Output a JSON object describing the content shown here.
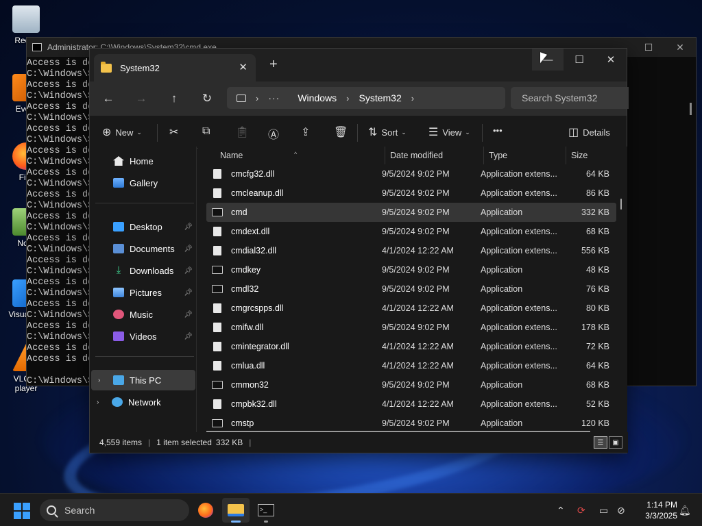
{
  "desktop": {
    "icons": [
      {
        "label": "Recyc"
      },
      {
        "label": "Every"
      },
      {
        "label": "Fire"
      },
      {
        "label": "Note"
      },
      {
        "label": "Visual Co"
      },
      {
        "label": "VLC m player"
      }
    ]
  },
  "cmd": {
    "title": "Administrator: C:\\Windows\\System32\\cmd.exe",
    "lines": [
      "Access is de",
      "C:\\Windows\\S",
      "Access is de",
      "C:\\Windows\\S",
      "Access is de",
      "C:\\Windows\\S",
      "Access is de",
      "C:\\Windows\\S",
      "Access is de",
      "C:\\Windows\\S",
      "Access is de",
      "C:\\Windows\\S",
      "Access is de",
      "C:\\Windows\\S",
      "Access is de",
      "C:\\Windows\\S",
      "Access is de",
      "C:\\Windows\\S",
      "Access is de",
      "C:\\Windows\\S",
      "Access is de",
      "C:\\Windows\\S",
      "Access is de",
      "C:\\Windows\\S",
      "Access is de",
      "C:\\Windows\\S",
      "Access is de",
      "Access is de",
      "",
      "C:\\Windows\\S"
    ]
  },
  "explorer": {
    "tab_title": "System32",
    "address": {
      "root": "Windows",
      "current": "System32"
    },
    "search_placeholder": "Search System32",
    "toolbar": {
      "new_label": "New",
      "sort_label": "Sort",
      "view_label": "View",
      "more_label": "•••",
      "details_label": "Details"
    },
    "nav": {
      "home": "Home",
      "gallery": "Gallery",
      "desktop": "Desktop",
      "documents": "Documents",
      "downloads": "Downloads",
      "pictures": "Pictures",
      "music": "Music",
      "videos": "Videos",
      "this_pc": "This PC",
      "network": "Network"
    },
    "columns": {
      "name": "Name",
      "date": "Date modified",
      "type": "Type",
      "size": "Size"
    },
    "files": [
      {
        "name": "cmcfg32.dll",
        "date": "9/5/2024 9:02 PM",
        "type": "Application extens...",
        "size": "64 KB",
        "kind": "dll"
      },
      {
        "name": "cmcleanup.dll",
        "date": "9/5/2024 9:02 PM",
        "type": "Application extens...",
        "size": "86 KB",
        "kind": "dll"
      },
      {
        "name": "cmd",
        "date": "9/5/2024 9:02 PM",
        "type": "Application",
        "size": "332 KB",
        "kind": "app"
      },
      {
        "name": "cmdext.dll",
        "date": "9/5/2024 9:02 PM",
        "type": "Application extens...",
        "size": "68 KB",
        "kind": "dll"
      },
      {
        "name": "cmdial32.dll",
        "date": "4/1/2024 12:22 AM",
        "type": "Application extens...",
        "size": "556 KB",
        "kind": "dll"
      },
      {
        "name": "cmdkey",
        "date": "9/5/2024 9:02 PM",
        "type": "Application",
        "size": "48 KB",
        "kind": "app"
      },
      {
        "name": "cmdl32",
        "date": "9/5/2024 9:02 PM",
        "type": "Application",
        "size": "76 KB",
        "kind": "app"
      },
      {
        "name": "cmgrcspps.dll",
        "date": "4/1/2024 12:22 AM",
        "type": "Application extens...",
        "size": "80 KB",
        "kind": "dll"
      },
      {
        "name": "cmifw.dll",
        "date": "9/5/2024 9:02 PM",
        "type": "Application extens...",
        "size": "178 KB",
        "kind": "dll"
      },
      {
        "name": "cmintegrator.dll",
        "date": "4/1/2024 12:22 AM",
        "type": "Application extens...",
        "size": "72 KB",
        "kind": "dll"
      },
      {
        "name": "cmlua.dll",
        "date": "4/1/2024 12:22 AM",
        "type": "Application extens...",
        "size": "64 KB",
        "kind": "dll"
      },
      {
        "name": "cmmon32",
        "date": "9/5/2024 9:02 PM",
        "type": "Application",
        "size": "68 KB",
        "kind": "app"
      },
      {
        "name": "cmpbk32.dll",
        "date": "4/1/2024 12:22 AM",
        "type": "Application extens...",
        "size": "52 KB",
        "kind": "dll"
      },
      {
        "name": "cmstp",
        "date": "9/5/2024 9:02 PM",
        "type": "Application",
        "size": "120 KB",
        "kind": "app"
      }
    ],
    "selected_file": "cmd",
    "status": {
      "items": "4,559 items",
      "selected": "1 item selected",
      "size": "332 KB"
    }
  },
  "taskbar": {
    "search_label": "Search",
    "time": "1:14 PM",
    "date": "3/3/2025"
  },
  "colors": {
    "accent": "#3aa0ff",
    "folder": "#f3c24b",
    "explorer_bg": "#191919",
    "selected_row": "#363636"
  }
}
